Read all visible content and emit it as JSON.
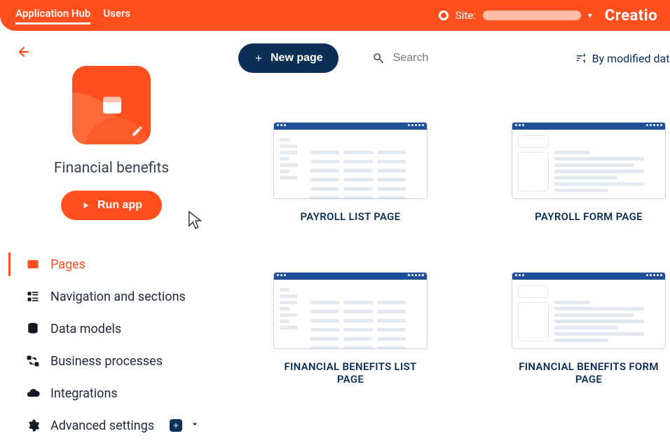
{
  "header": {
    "nav": [
      {
        "label": "Application Hub",
        "active": true
      },
      {
        "label": "Users",
        "active": false
      }
    ],
    "site_label": "Site:",
    "logo": "Creatio"
  },
  "left": {
    "app_name": "Financial benefits",
    "run_label": "Run app"
  },
  "sidenav": {
    "items": [
      {
        "key": "pages",
        "label": "Pages",
        "active": true
      },
      {
        "key": "nav",
        "label": "Navigation and sections"
      },
      {
        "key": "data",
        "label": "Data models"
      },
      {
        "key": "bp",
        "label": "Business processes"
      },
      {
        "key": "int",
        "label": "Integrations"
      },
      {
        "key": "adv",
        "label": "Advanced settings"
      }
    ]
  },
  "toolbar": {
    "new_page": "New page",
    "search_placeholder": "Search",
    "sort_label": "By modified date"
  },
  "cards": [
    {
      "type": "list",
      "label": "PAYROLL LIST PAGE"
    },
    {
      "type": "form",
      "label": "PAYROLL FORM PAGE"
    },
    {
      "type": "list",
      "label": "FINANCIAL BENEFITS LIST PAGE"
    },
    {
      "type": "form",
      "label": "FINANCIAL BENEFITS FORM PAGE"
    }
  ],
  "colors": {
    "accent": "#ff4f1f",
    "navy": "#0d2e56"
  }
}
